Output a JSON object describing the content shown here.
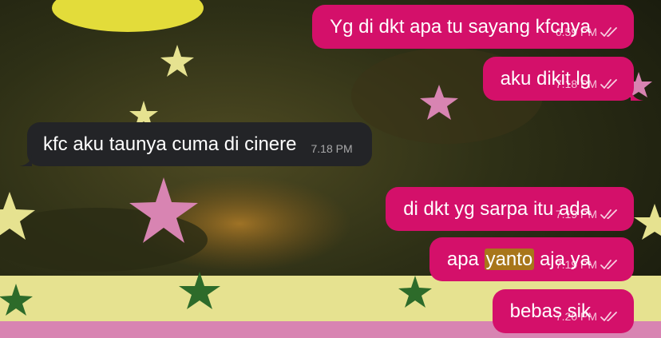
{
  "chat": {
    "messages": [
      {
        "direction": "outgoing",
        "text": "Yg di dkt apa tu sayang kfcnya",
        "time": "6.59 PM",
        "status": "read"
      },
      {
        "direction": "outgoing",
        "text": "aku dikit lg",
        "time": "7.18 PM",
        "status": "read"
      },
      {
        "direction": "incoming",
        "text": "kfc aku taunya cuma di cinere",
        "time": "7.18 PM"
      },
      {
        "direction": "outgoing",
        "text": "di dkt yg sarpa itu ada",
        "time": "7.19 PM",
        "status": "read"
      },
      {
        "direction": "outgoing",
        "text_before": "apa ",
        "text_highlight": "yanto",
        "text_after": " aja ya",
        "time": "7.19 PM",
        "status": "read"
      },
      {
        "direction": "outgoing",
        "text": "bebas sik",
        "time": "7.20 PM",
        "status": "read"
      }
    ]
  },
  "colors": {
    "outgoing_bubble": "#d4106a",
    "incoming_bubble": "#232427",
    "highlight": "#a8761a"
  },
  "icons": {
    "read_receipt": "double-check-icon"
  }
}
